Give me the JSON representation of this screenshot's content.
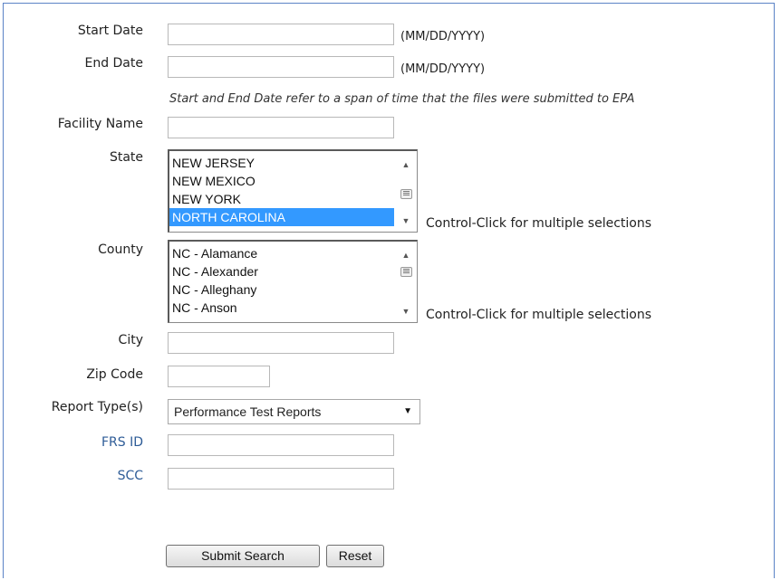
{
  "form": {
    "start_date": {
      "label": "Start Date",
      "value": "",
      "hint": "(MM/DD/YYYY)"
    },
    "end_date": {
      "label": "End Date",
      "value": "",
      "hint": "(MM/DD/YYYY)"
    },
    "date_note": "Start and End Date refer to a span of time that the files were submitted to EPA",
    "facility_name": {
      "label": "Facility Name",
      "value": ""
    },
    "state": {
      "label": "State",
      "options": [
        "NEW JERSEY",
        "NEW MEXICO",
        "NEW YORK",
        "NORTH CAROLINA"
      ],
      "selected": "NORTH CAROLINA",
      "hint": "Control-Click for multiple selections"
    },
    "county": {
      "label": "County",
      "options": [
        "NC - Alamance",
        "NC - Alexander",
        "NC - Alleghany",
        "NC - Anson"
      ],
      "hint": "Control-Click for multiple selections"
    },
    "city": {
      "label": "City",
      "value": ""
    },
    "zip_code": {
      "label": "Zip Code",
      "value": ""
    },
    "report_type": {
      "label": "Report Type(s)",
      "selected": "Performance Test Reports"
    },
    "frs_id": {
      "label": "FRS ID",
      "value": ""
    },
    "scc": {
      "label": "SCC",
      "value": ""
    },
    "submit_label": "Submit Search",
    "reset_label": "Reset"
  },
  "colors": {
    "border_accent": "#5b83c6",
    "link_label": "#2e5c97",
    "selection": "#3399ff"
  }
}
